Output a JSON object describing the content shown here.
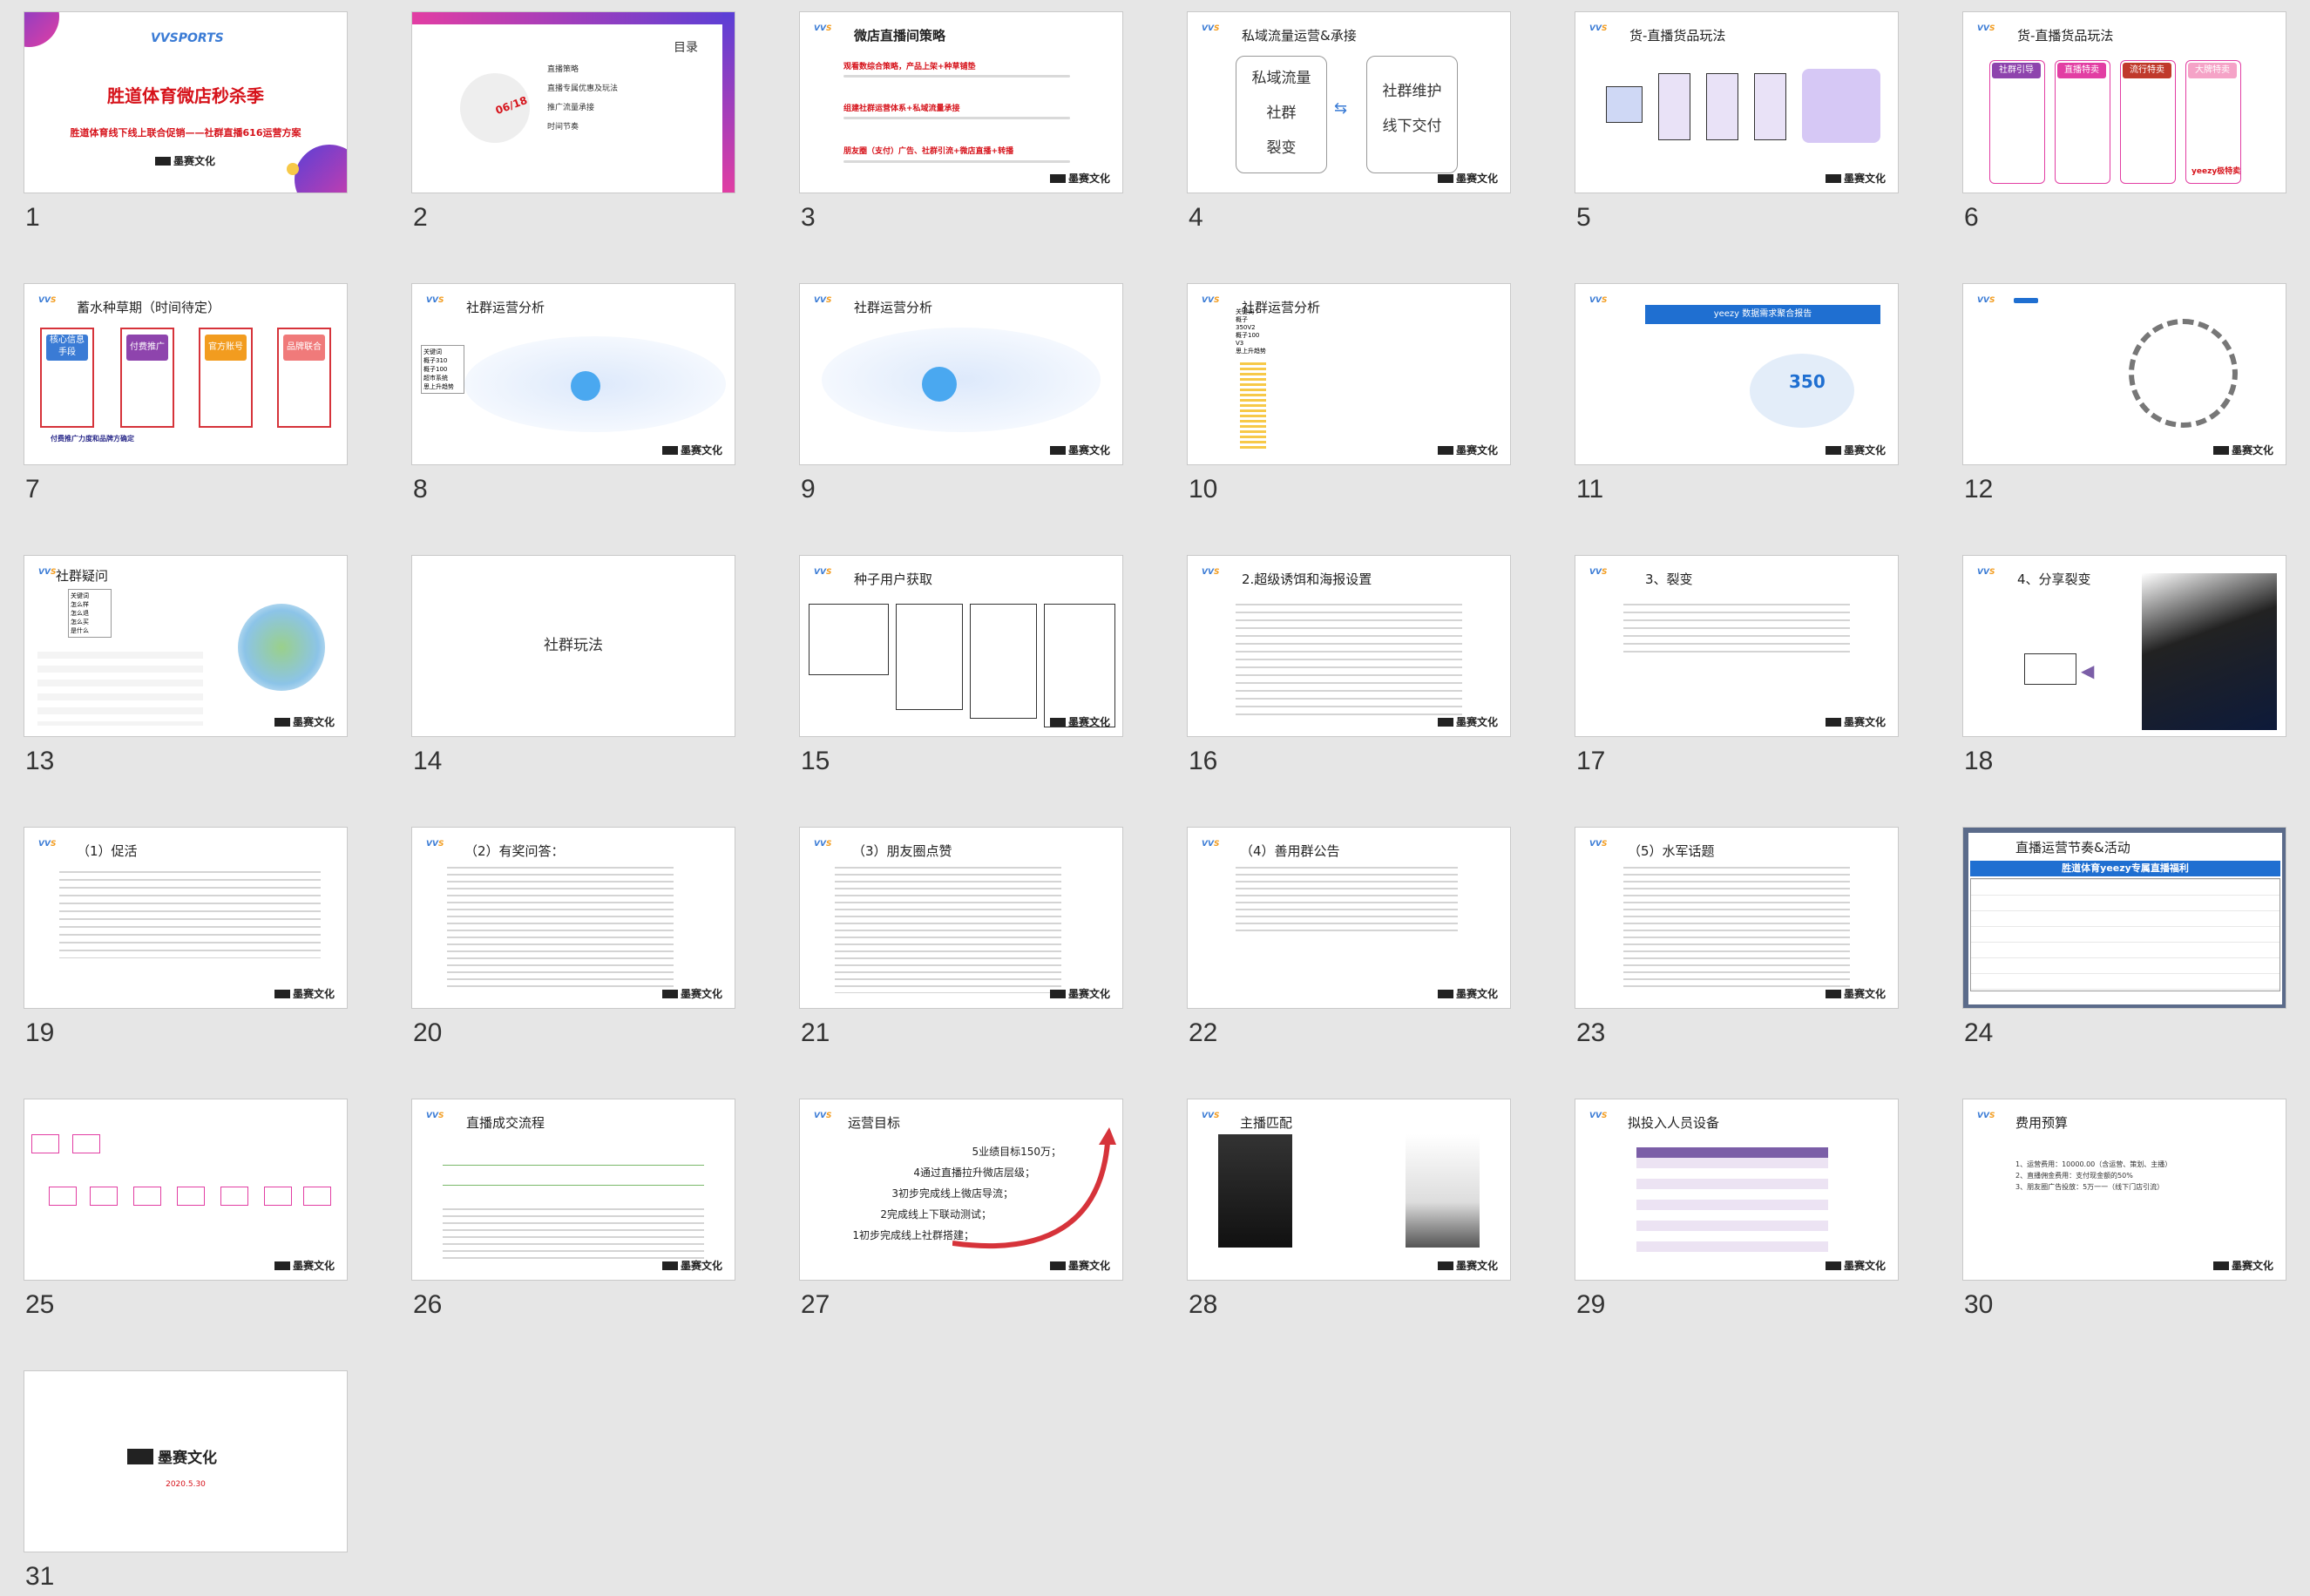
{
  "slides": [
    {
      "num": "1",
      "title": "胜道体育微店秒杀季",
      "subtitle": "胜道体育线下线上联合促销——社群直播616运营方案",
      "logo": "VVSPORTS",
      "brand": "墨赛文化"
    },
    {
      "num": "2",
      "title": "目录",
      "badge": "06/18",
      "items": [
        "直播策略",
        "直播专属优惠及玩法",
        "推广流量承接",
        "时间节奏"
      ]
    },
    {
      "num": "3",
      "title": "微店直播间策略",
      "items": [
        "观看数综合策略，产品上架+种草铺垫",
        "组建社群运营体系+私域流量承接",
        "朋友圈（支付）广告、社群引流+微店直播+转播"
      ]
    },
    {
      "num": "4",
      "title": "私域流量运营&承接",
      "left": [
        "私域流量",
        "社群",
        "裂变"
      ],
      "right": [
        "社群维护",
        "线下交付"
      ]
    },
    {
      "num": "5",
      "title": "货-直播货品玩法"
    },
    {
      "num": "6",
      "title": "货-直播货品玩法",
      "tags": [
        "社群引导",
        "直播特卖",
        "流行特卖",
        "大牌特卖"
      ],
      "note": "yeezy极特卖"
    },
    {
      "num": "7",
      "title": "蓄水种草期（时间待定）",
      "tags": [
        "核心信息手段",
        "付费推广",
        "官方账号",
        "品牌联合"
      ],
      "footer": "付费推广力度和品牌方确定"
    },
    {
      "num": "8",
      "title": "社群运营分析",
      "list": [
        "关键词",
        "概子310",
        "概子100",
        "超市系统",
        "思上升趋势"
      ]
    },
    {
      "num": "9",
      "title": "社群运营分析"
    },
    {
      "num": "10",
      "title": "社群运营分析",
      "list": [
        "关键词",
        "概子",
        "350V2",
        "概子100",
        "V3",
        "思上升趋势"
      ]
    },
    {
      "num": "11",
      "title": "yeezy 数据需求聚合报告",
      "badge": "350"
    },
    {
      "num": "12",
      "title": ""
    },
    {
      "num": "13",
      "title": "社群疑问",
      "list": [
        "关键词",
        "怎么样",
        "怎么退",
        "怎么买",
        "是什么"
      ]
    },
    {
      "num": "14",
      "title": "社群玩法"
    },
    {
      "num": "15",
      "title": "种子用户获取"
    },
    {
      "num": "16",
      "title": "2.超级诱饵和海报设置"
    },
    {
      "num": "17",
      "title": "3、裂变"
    },
    {
      "num": "18",
      "title": "4、分享裂变"
    },
    {
      "num": "19",
      "title": "（1）促活"
    },
    {
      "num": "20",
      "title": "（2）有奖问答："
    },
    {
      "num": "21",
      "title": "（3）朋友圈点赞"
    },
    {
      "num": "22",
      "title": "（4）善用群公告"
    },
    {
      "num": "23",
      "title": "（5）水军话题"
    },
    {
      "num": "24",
      "title": "直播运营节奏&活动",
      "banner": "胜道体育yeezy专属直播福利"
    },
    {
      "num": "25",
      "title": ""
    },
    {
      "num": "26",
      "title": "直播成交流程"
    },
    {
      "num": "27",
      "title": "运营目标",
      "goals": [
        "5业绩目标150万；",
        "4通过直播拉升微店层级；",
        "3初步完成线上微店导流；",
        "2完成线上下联动测试；",
        "1初步完成线上社群搭建；"
      ]
    },
    {
      "num": "28",
      "title": "主播匹配"
    },
    {
      "num": "29",
      "title": "拟投入人员设备"
    },
    {
      "num": "30",
      "title": "费用预算",
      "items": [
        "1、运营费用：10000.00（含运营、策划、主播）",
        "2、直播佣金费用：支付现金额的50%",
        "3、朋友圈广告投放：5万一一（线下门店引流）"
      ]
    },
    {
      "num": "31",
      "title": "墨赛文化",
      "date": "2020.5.30"
    }
  ],
  "colors": {
    "background": "#e6e6e6",
    "accent_red": "#d6121a",
    "brand_purple": "#7b5ea7",
    "brand_blue": "#3a7bd5"
  }
}
